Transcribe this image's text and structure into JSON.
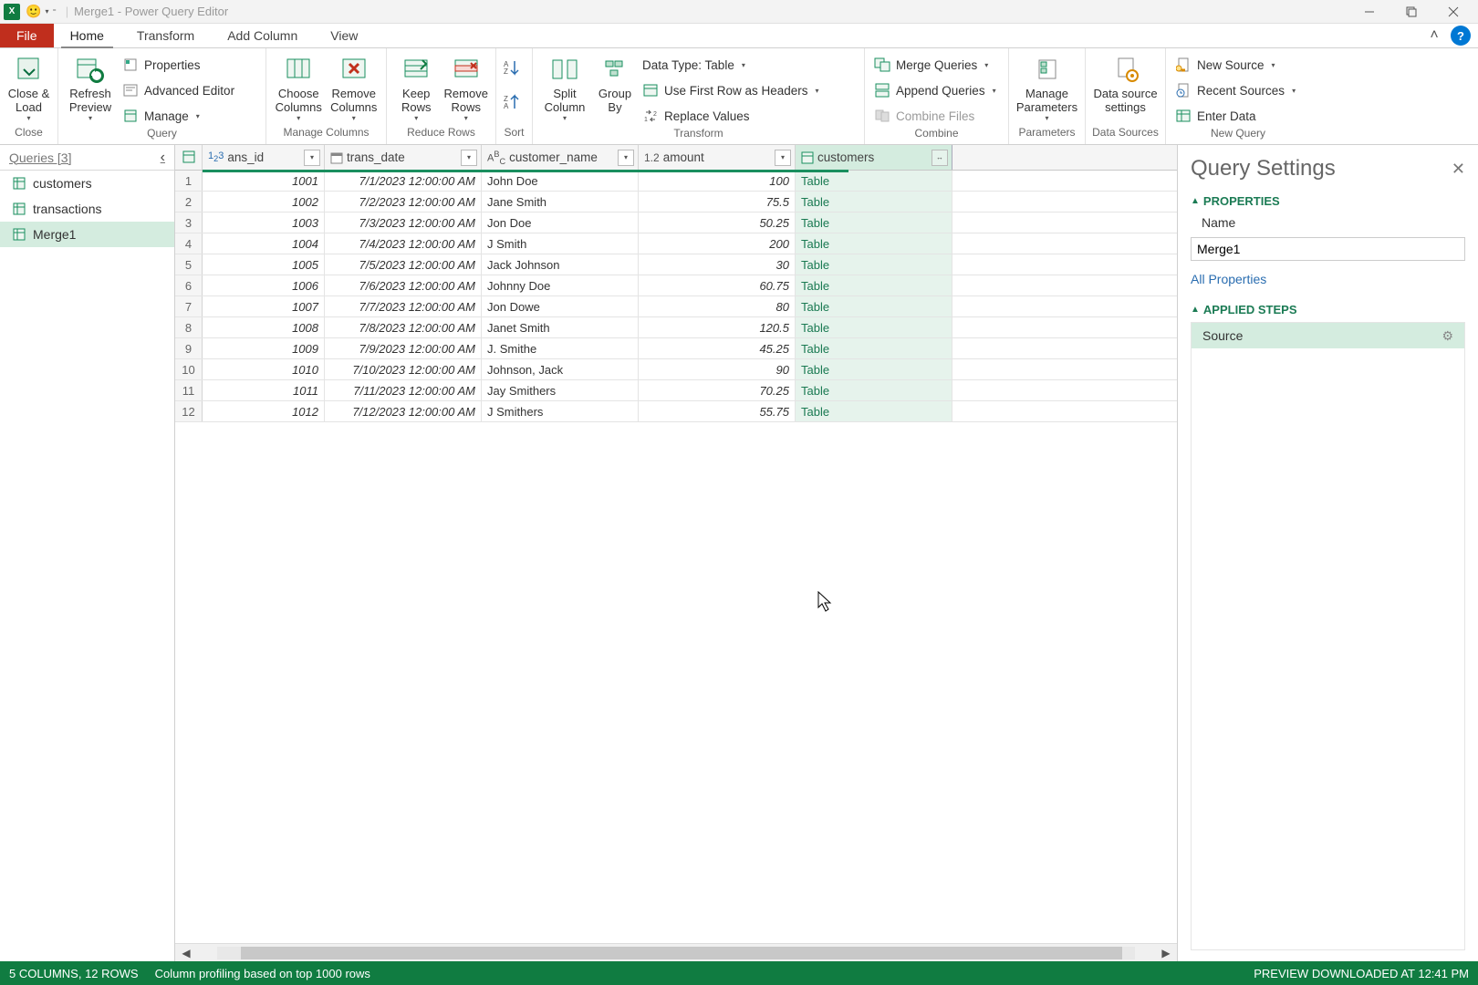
{
  "window": {
    "title": "Merge1 - Power Query Editor"
  },
  "tabs": {
    "file": "File",
    "home": "Home",
    "transform": "Transform",
    "addcol": "Add Column",
    "view": "View"
  },
  "ribbon": {
    "close_load": "Close &\nLoad",
    "refresh": "Refresh\nPreview",
    "properties": "Properties",
    "adv_editor": "Advanced Editor",
    "manage": "Manage",
    "choose_cols": "Choose\nColumns",
    "remove_cols": "Remove\nColumns",
    "keep_rows": "Keep\nRows",
    "remove_rows": "Remove\nRows",
    "split_col": "Split\nColumn",
    "group_by": "Group\nBy",
    "data_type": "Data Type: Table",
    "first_row": "Use First Row as Headers",
    "replace": "Replace Values",
    "merge_q": "Merge Queries",
    "append_q": "Append Queries",
    "combine_files": "Combine Files",
    "manage_params": "Manage\nParameters",
    "ds_settings": "Data source\nsettings",
    "new_source": "New Source",
    "recent_sources": "Recent Sources",
    "enter_data": "Enter Data",
    "g_close": "Close",
    "g_query": "Query",
    "g_managecols": "Manage Columns",
    "g_reducerows": "Reduce Rows",
    "g_sort": "Sort",
    "g_transform": "Transform",
    "g_combine": "Combine",
    "g_params": "Parameters",
    "g_ds": "Data Sources",
    "g_newquery": "New Query"
  },
  "queries": {
    "header": "Queries [3]",
    "items": [
      "customers",
      "transactions",
      "Merge1"
    ],
    "selected": 2
  },
  "columns": [
    {
      "name": "ans_id",
      "type": "int"
    },
    {
      "name": "trans_date",
      "type": "date"
    },
    {
      "name": "customer_name",
      "type": "text"
    },
    {
      "name": "amount",
      "type": "num"
    },
    {
      "name": "customers",
      "type": "table"
    }
  ],
  "rows": [
    {
      "id": "1001",
      "date": "7/1/2023 12:00:00 AM",
      "name": "John Doe",
      "amt": "100",
      "t": "Table"
    },
    {
      "id": "1002",
      "date": "7/2/2023 12:00:00 AM",
      "name": "Jane Smith",
      "amt": "75.5",
      "t": "Table"
    },
    {
      "id": "1003",
      "date": "7/3/2023 12:00:00 AM",
      "name": "Jon Doe",
      "amt": "50.25",
      "t": "Table"
    },
    {
      "id": "1004",
      "date": "7/4/2023 12:00:00 AM",
      "name": "J Smith",
      "amt": "200",
      "t": "Table"
    },
    {
      "id": "1005",
      "date": "7/5/2023 12:00:00 AM",
      "name": "Jack Johnson",
      "amt": "30",
      "t": "Table"
    },
    {
      "id": "1006",
      "date": "7/6/2023 12:00:00 AM",
      "name": "Johnny Doe",
      "amt": "60.75",
      "t": "Table"
    },
    {
      "id": "1007",
      "date": "7/7/2023 12:00:00 AM",
      "name": "Jon Dowe",
      "amt": "80",
      "t": "Table"
    },
    {
      "id": "1008",
      "date": "7/8/2023 12:00:00 AM",
      "name": "Janet Smith",
      "amt": "120.5",
      "t": "Table"
    },
    {
      "id": "1009",
      "date": "7/9/2023 12:00:00 AM",
      "name": "J. Smithe",
      "amt": "45.25",
      "t": "Table"
    },
    {
      "id": "1010",
      "date": "7/10/2023 12:00:00 AM",
      "name": "Johnson, Jack",
      "amt": "90",
      "t": "Table"
    },
    {
      "id": "1011",
      "date": "7/11/2023 12:00:00 AM",
      "name": "Jay Smithers",
      "amt": "70.25",
      "t": "Table"
    },
    {
      "id": "1012",
      "date": "7/12/2023 12:00:00 AM",
      "name": "J Smithers",
      "amt": "55.75",
      "t": "Table"
    }
  ],
  "settings": {
    "title": "Query Settings",
    "properties": "PROPERTIES",
    "name_label": "Name",
    "name_value": "Merge1",
    "all_props": "All Properties",
    "applied_steps": "APPLIED STEPS",
    "step_source": "Source"
  },
  "status": {
    "cols_rows": "5 COLUMNS, 12 ROWS",
    "profiling": "Column profiling based on top 1000 rows",
    "preview": "PREVIEW DOWNLOADED AT 12:41 PM"
  }
}
